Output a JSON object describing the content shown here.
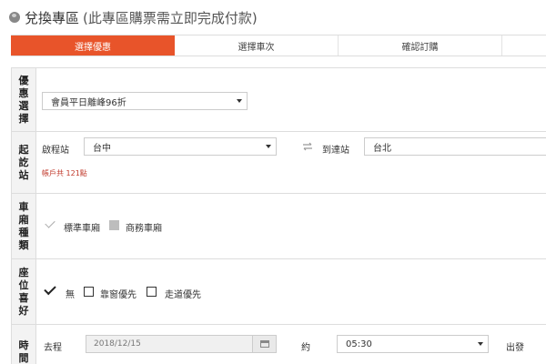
{
  "header": {
    "title": "兌換專區",
    "note": "(此專區購票需立即完成付款)",
    "icon": "globe-icon"
  },
  "steps": [
    {
      "label": "選擇優惠",
      "active": true
    },
    {
      "label": "選擇車次",
      "active": false
    },
    {
      "label": "確認訂購",
      "active": false
    },
    {
      "label": "",
      "active": false
    }
  ],
  "colors": {
    "accent": "#e8542a",
    "note": "#c0392b"
  },
  "discount": {
    "label": [
      "優",
      "惠",
      "選",
      "擇"
    ],
    "selected": "會員平日離峰96折"
  },
  "stations": {
    "label": [
      "起",
      "訖",
      "站"
    ],
    "origin_label": "啟程站",
    "origin_value": "台中",
    "dest_label": "到達站",
    "dest_value": "台北",
    "points_note": "帳戶共 121點",
    "swap_icon": "swap-icon"
  },
  "car_type": {
    "label": [
      "車",
      "廂",
      "種",
      "類"
    ],
    "standard": "標準車廂",
    "business": "商務車廂"
  },
  "seat_pref": {
    "label": [
      "座",
      "位",
      "喜",
      "好"
    ],
    "none": "無",
    "window": "靠窗優先",
    "aisle": "走道優先"
  },
  "time": {
    "label": [
      "時",
      "間"
    ],
    "trip_label": "去程",
    "date_value": "2018/12/15",
    "about_label": "約",
    "time_value": "05:30",
    "depart_label": "出發"
  }
}
